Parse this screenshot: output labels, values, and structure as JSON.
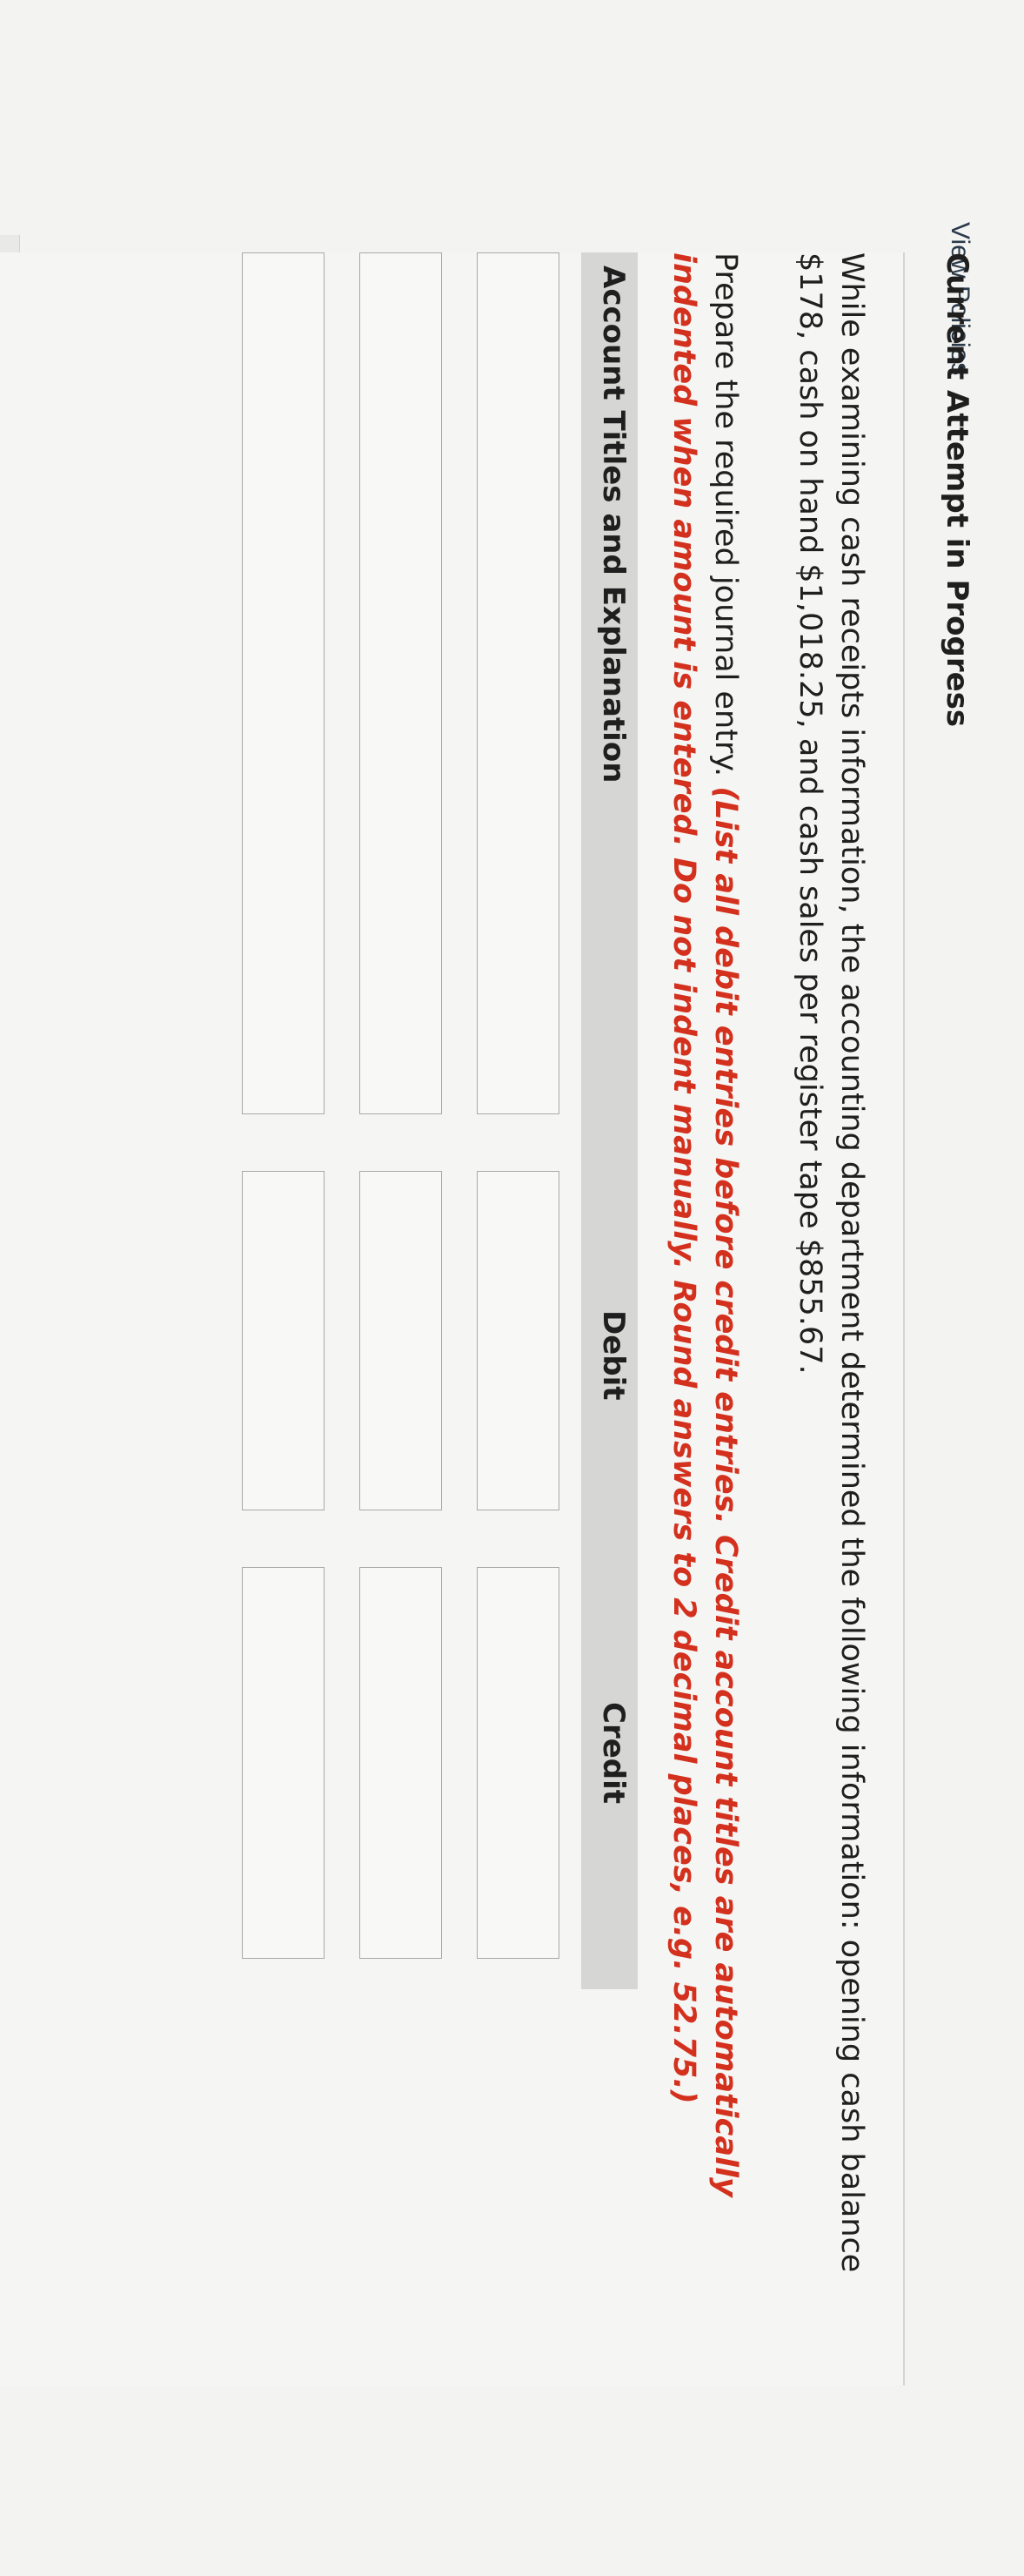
{
  "view_policies_link": "View Policies",
  "attempt_title": "Current Attempt in Progress",
  "question_text": "While examining cash receipts information, the accounting department determined the following information: opening cash balance $178, cash on hand $1,018.25, and cash sales per register tape $855.67.",
  "instructions": {
    "lead": "Prepare the required journal entry. ",
    "hint": "(List all debit entries before credit entries. Credit account titles are automatically indented when amount is entered. Do not indent manually. Round answers to 2 decimal places, e.g. 52.75.)"
  },
  "journal_table": {
    "headers": {
      "account": "Account Titles and Explanation",
      "debit": "Debit",
      "credit": "Credit"
    },
    "rows": [
      {
        "account": "",
        "debit": "",
        "credit": ""
      },
      {
        "account": "",
        "debit": "",
        "credit": ""
      },
      {
        "account": "",
        "debit": "",
        "credit": ""
      }
    ]
  },
  "colors": {
    "hint_red": "#d3301d",
    "header_bg": "#d6d6d4",
    "input_border": "#a9a9a7"
  }
}
